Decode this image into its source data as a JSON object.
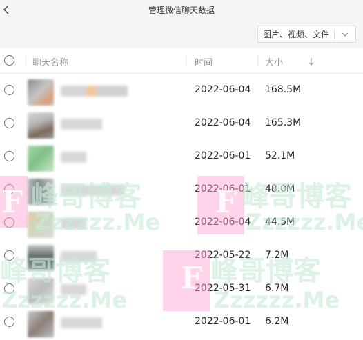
{
  "window": {
    "title": "管理微信聊天数据"
  },
  "toolbar": {
    "filter_value": "图片、视频、文件"
  },
  "table": {
    "columns": {
      "name": "聊天名称",
      "time": "时间",
      "size": "大小"
    },
    "sort_indicator": "↓",
    "rows": [
      {
        "date": "2022-06-04",
        "size": "168.5M"
      },
      {
        "date": "2022-06-04",
        "size": "165.3M"
      },
      {
        "date": "2022-06-01",
        "size": "52.1M"
      },
      {
        "date": "2022-06-01",
        "size": "48.0M"
      },
      {
        "date": "2022-06-04",
        "size": "44.5M"
      },
      {
        "date": "2022-05-22",
        "size": "7.2M"
      },
      {
        "date": "2022-05-31",
        "size": "6.7M"
      },
      {
        "date": "2022-06-01",
        "size": "6.2M"
      }
    ]
  },
  "watermark": {
    "cn": "峰哥博客",
    "en": "Zzzzzz.Me",
    "letter": "F"
  },
  "colors": {
    "background": "#ffffff",
    "header_bar": "#f5f5f5",
    "watermark_pink": "#ffb4d9",
    "watermark_green": "#c8ebd7"
  }
}
